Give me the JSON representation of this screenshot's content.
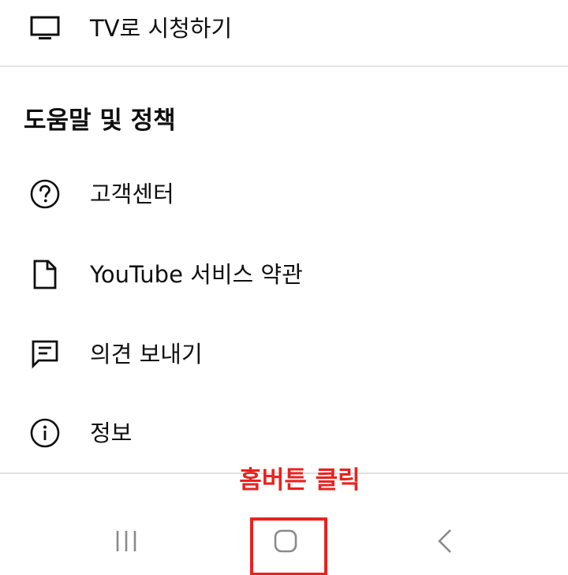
{
  "menu": {
    "watch_on_tv": {
      "label": "TV로 시청하기",
      "icon": "tv-icon"
    },
    "help_section_title": "도움말 및 정책",
    "items": [
      {
        "label": "고객센터",
        "icon": "help-circle-icon"
      },
      {
        "label": "YouTube 서비스 약관",
        "icon": "document-icon"
      },
      {
        "label": "의견 보내기",
        "icon": "feedback-icon"
      },
      {
        "label": "정보",
        "icon": "info-icon"
      }
    ]
  },
  "annotation": {
    "text": "홈버튼 클릭",
    "color": "#e8231f"
  },
  "navbar": {
    "recents_icon": "recent-apps-icon",
    "home_icon": "home-icon",
    "back_icon": "back-icon"
  },
  "colors": {
    "text": "#0f0f0f",
    "divider": "#e5e5e5",
    "nav_icon": "#8a8a8a",
    "highlight": "#e8231f"
  }
}
